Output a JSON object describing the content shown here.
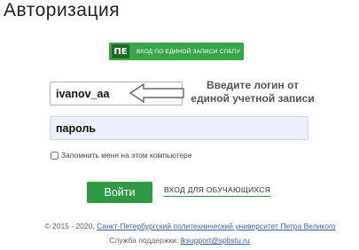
{
  "page": {
    "title": "Авторизация"
  },
  "sso_button": {
    "logo": "ПЕ",
    "label": "вход по единой записи спбпу"
  },
  "login": {
    "value": "ivanov_aa",
    "hint": "Введите логин от единой учетной записи"
  },
  "password": {
    "value": "пароль"
  },
  "remember": {
    "label": "Запомнить меня на этом компьютере"
  },
  "submit": {
    "label": "Войти"
  },
  "student_link": {
    "label": "вход для обучающихся"
  },
  "footer": {
    "copyright": "© 2015 - 2020,",
    "university": "Санкт-Петербургский политехнический университет Петра Великого",
    "support_label": "Служба поддержки:",
    "support_email": "lksupport@spbstu.ru"
  },
  "colors": {
    "accent": "#2f9a45",
    "field_bg": "#eaf1fd"
  }
}
